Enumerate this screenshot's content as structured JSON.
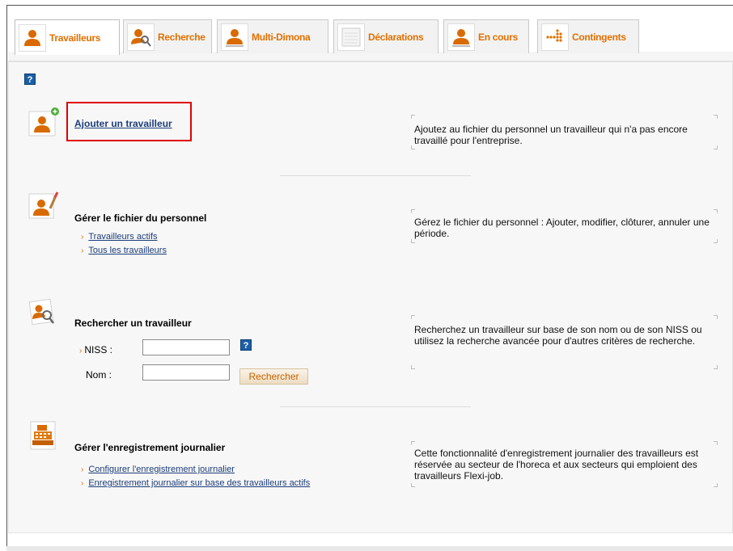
{
  "tabs": [
    {
      "label": "Travailleurs",
      "icon": "worker-icon",
      "active": true
    },
    {
      "label": "Recherche",
      "icon": "search-worker-icon",
      "active": false
    },
    {
      "label": "Multi-Dimona",
      "icon": "multi-worker-icon",
      "active": false
    },
    {
      "label": "Déclarations",
      "icon": "document-icon",
      "active": false
    },
    {
      "label": "En cours",
      "icon": "worker-pending-icon",
      "active": false
    },
    {
      "label": "Contingents",
      "icon": "grid-dots-icon",
      "active": false
    }
  ],
  "help_label": "?",
  "sections": {
    "add": {
      "link": "Ajouter un travailleur",
      "description": "Ajoutez au fichier du personnel un travailleur qui n'a pas encore travaillé pour l'entreprise."
    },
    "manage": {
      "title": "Gérer le fichier du personnel",
      "links": [
        "Travailleurs actifs",
        "Tous les travailleurs"
      ],
      "description": "Gérez le fichier du personnel : Ajouter, modifier, clôturer, annuler une période."
    },
    "search": {
      "title": "Rechercher un travailleur",
      "niss_label": "NISS :",
      "name_label": "Nom :",
      "niss_value": "",
      "name_value": "",
      "button": "Rechercher",
      "description": "Recherchez un travailleur sur base de son nom ou de son NISS ou utilisez la recherche avancée pour d'autres critères de recherche."
    },
    "daily": {
      "title": "Gérer l'enregistrement journalier",
      "links": [
        "Configurer l'enregistrement journalier",
        "Enregistrement journalier sur base des travailleurs actifs"
      ],
      "description": "Cette fonctionnalité d'enregistrement journalier des travailleurs est réservée au secteur de l'horeca et aux secteurs qui emploient des travailleurs Flexi-job."
    }
  },
  "colors": {
    "accent": "#e07000",
    "link": "#1c3d7a",
    "highlight": "#e00000",
    "help": "#1b5fa8"
  }
}
